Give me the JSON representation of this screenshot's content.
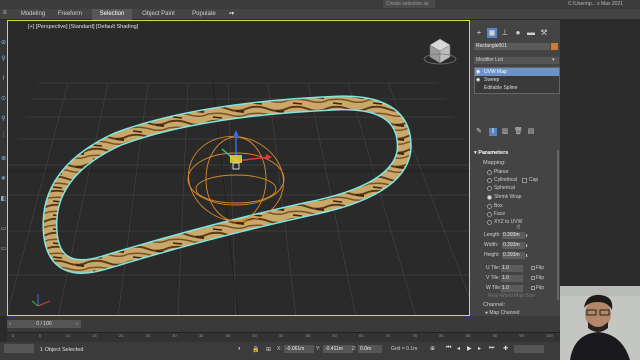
{
  "titlebar": {
    "search_placeholder": "Create selection se",
    "path": "C:\\Users\\p... s Max 2021"
  },
  "ribbon": {
    "tabs": [
      {
        "label": "Modeling"
      },
      {
        "label": "Freeform"
      },
      {
        "label": "Selection"
      },
      {
        "label": "Object Paint"
      },
      {
        "label": "Populate"
      }
    ]
  },
  "viewport": {
    "label": "[+] [Perspective] [Standard] [Default Shading]"
  },
  "command_panel": {
    "object_name": "Rectangle001",
    "object_color": "#d27a28",
    "modifier_list_label": "Modifier List",
    "stack": [
      {
        "label": "UVW Map",
        "selected": true
      },
      {
        "label": "Sweep",
        "selected": false
      },
      {
        "label": "Editable Spline",
        "selected": false
      }
    ],
    "parameters_title": "Parameters",
    "mapping_label": "Mapping:",
    "mapping_options": [
      "Planar",
      "Cylindrical",
      "Spherical",
      "Shrink Wrap",
      "Box",
      "Face",
      "XYZ to UVW"
    ],
    "mapping_selected": "Shrink Wrap",
    "cap_label": "Cap",
    "length_label": "Length:",
    "length_value": "0.393m",
    "width_label": "Width:",
    "width_value": "0.393m",
    "height_label": "Height:",
    "height_value": "0.393m",
    "u_tile_label": "U Tile:",
    "u_tile_value": "1.0",
    "v_tile_label": "V Tile:",
    "v_tile_value": "1.0",
    "w_tile_label": "W Tile:",
    "w_tile_value": "1.0",
    "flip_label": "Flip",
    "real_world_label": "Real-World Map Size",
    "channel_label": "Channel:",
    "map_channel_label": "Map Channel:"
  },
  "timeline": {
    "frame_label": "0 / 100",
    "ticks": [
      "0",
      "5",
      "10",
      "15",
      "20",
      "25",
      "30",
      "35",
      "40",
      "45",
      "50",
      "55",
      "60",
      "65",
      "70",
      "75",
      "80",
      "85",
      "90",
      "95",
      "100"
    ]
  },
  "status": {
    "selection_text": "1 Object Selected",
    "x_label": "X:",
    "x_value": "-0.061m",
    "y_label": "Y:",
    "y_value": "-0.411m",
    "z_label": "Z:",
    "z_value": "0.0m",
    "grid_label": "Grid = 0.1m"
  },
  "colors": {
    "viewport_border": "#d9d939",
    "selection_outline": "#7fe6e6",
    "gizmo_orange": "#d98a2a",
    "stack_selected": "#6c93c8"
  }
}
